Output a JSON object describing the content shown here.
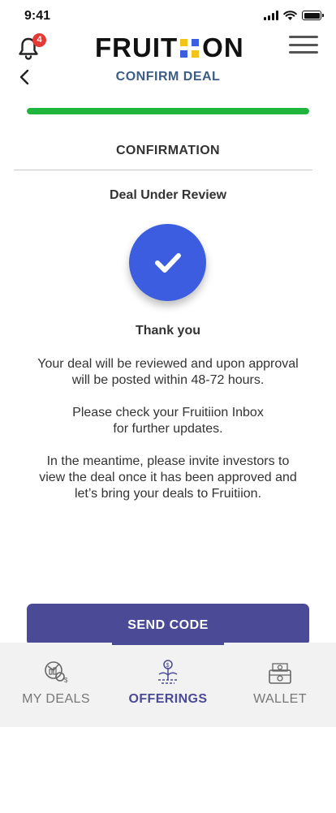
{
  "status_bar": {
    "time": "9:41"
  },
  "header": {
    "notification_count": "4",
    "logo_left": "FRUIT",
    "logo_right": "ON",
    "logo_mark_colors": [
      "#f2c417",
      "#3d5de0",
      "#3d5de0",
      "#f2c417"
    ],
    "title": "CONFIRM DEAL"
  },
  "progress": {
    "value": 1.0,
    "color": "#1fb53d"
  },
  "section": {
    "title": "CONFIRMATION"
  },
  "content": {
    "heading": "Deal Under Review",
    "check_icon": "check-icon",
    "thank_you": "Thank you",
    "message_1_line1": "Your deal will be reviewed and upon approval",
    "message_1_line2": "will be posted within 48-72 hours.",
    "message_2_line1": "Please check your Fruitiion Inbox",
    "message_2_line2": "for further updates.",
    "message_3_line1": "In the meantime, please invite investors to",
    "message_3_line2": "view the deal once it has been approved and",
    "message_3_line3": "let’s bring your deals to Fruitiion."
  },
  "actions": {
    "send_code_label": "SEND CODE",
    "accent": "#4b4a97"
  },
  "tabs": [
    {
      "label": "MY DEALS",
      "icon": "deals-icon",
      "active": false
    },
    {
      "label": "OFFERINGS",
      "icon": "offerings-icon",
      "active": true
    },
    {
      "label": "WALLET",
      "icon": "wallet-icon",
      "active": false
    }
  ]
}
